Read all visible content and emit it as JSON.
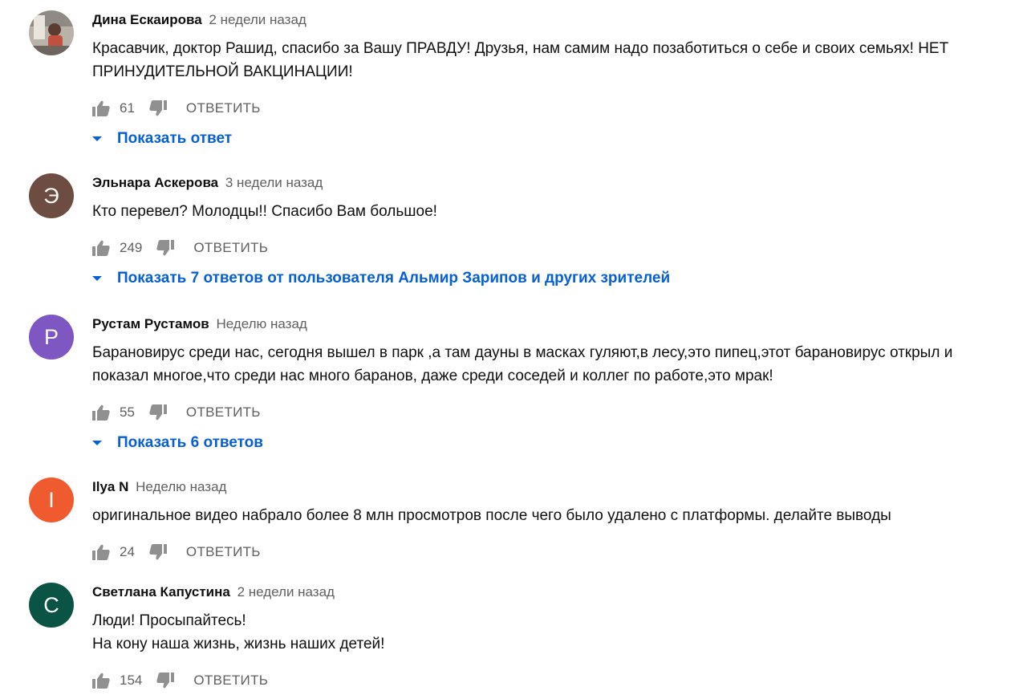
{
  "comments": [
    {
      "author": "Дина Ескаирова",
      "time": "2 недели назад",
      "text": "Красавчик, доктор Рашид, спасибо за Вашу ПРАВДУ! Друзья, нам самим надо позаботиться о себе и своих семьях! НЕТ ПРИНУДИТЕЛЬНОЙ ВАКЦИНАЦИИ!",
      "likes": "61",
      "reply_label": "ОТВЕТИТЬ",
      "replies_label": "Показать ответ"
    },
    {
      "author": "Эльнара Аскерова",
      "time": "3 недели назад",
      "avatar_letter": "Э",
      "avatar_color": "#6d4c41",
      "text": "Кто перевел? Молодцы!! Спасибо Вам большое!",
      "likes": "249",
      "reply_label": "ОТВЕТИТЬ",
      "replies_label": "Показать 7 ответов от пользователя Альмир Зарипов и других зрителей"
    },
    {
      "author": "Рустам Рустамов",
      "time": "Неделю назад",
      "avatar_letter": "Р",
      "avatar_color": "#7e57c2",
      "text": "Барановирус среди нас, сегодня вышел в парк ,а там дауны в масках гуляют,в лесу,это пипец,этот барановирус открыл и показал многое,что среди нас много баранов, даже среди соседей и коллег по работе,это мрак!",
      "likes": "55",
      "reply_label": "ОТВЕТИТЬ",
      "replies_label": "Показать 6 ответов"
    },
    {
      "author": "Ilya N",
      "time": "Неделю назад",
      "avatar_letter": "I",
      "avatar_color": "#ef5a2f",
      "text": "оригинальное видео набрало более 8 млн просмотров после чего было удалено с платформы. делайте выводы",
      "likes": "24",
      "reply_label": "ОТВЕТИТЬ"
    },
    {
      "author": "Светлана Капустина",
      "time": "2 недели назад",
      "avatar_letter": "С",
      "avatar_color": "#0b5345",
      "text": "Люди! Просыпайтесь!\nНа кону наша жизнь, жизнь наших детей!",
      "likes": "154",
      "reply_label": "ОТВЕТИТЬ"
    }
  ]
}
